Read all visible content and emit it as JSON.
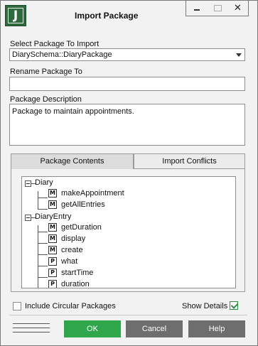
{
  "window": {
    "title": "Import Package",
    "close_glyph": "✕",
    "app_icon_letter": "J"
  },
  "select_package": {
    "label": "Select Package To Import",
    "value": "DiarySchema::DiaryPackage"
  },
  "rename_package": {
    "label": "Rename Package To",
    "value": ""
  },
  "package_description": {
    "label": "Package Description",
    "value": "Package to maintain appointments."
  },
  "tabs": [
    {
      "label": "Package Contents",
      "active": true
    },
    {
      "label": "Import Conflicts",
      "active": false
    }
  ],
  "tree": {
    "groups": [
      {
        "name": "Diary",
        "children": [
          {
            "badge": "M",
            "name": "makeAppointment"
          },
          {
            "badge": "M",
            "name": "getAllEntries"
          }
        ]
      },
      {
        "name": "DiaryEntry",
        "children": [
          {
            "badge": "M",
            "name": "getDuration"
          },
          {
            "badge": "M",
            "name": "display"
          },
          {
            "badge": "M",
            "name": "create"
          },
          {
            "badge": "P",
            "name": "what"
          },
          {
            "badge": "P",
            "name": "startTime"
          },
          {
            "badge": "P",
            "name": "duration"
          }
        ]
      }
    ]
  },
  "options": {
    "include_circular": {
      "label": "Include Circular Packages",
      "checked": false
    },
    "show_details": {
      "label": "Show Details",
      "checked": true
    }
  },
  "buttons": {
    "ok": "OK",
    "cancel": "Cancel",
    "help": "Help"
  },
  "colors": {
    "accent_green": "#2fa64b",
    "button_gray": "#6e6e6e",
    "icon_green": "#2d6b3f"
  }
}
